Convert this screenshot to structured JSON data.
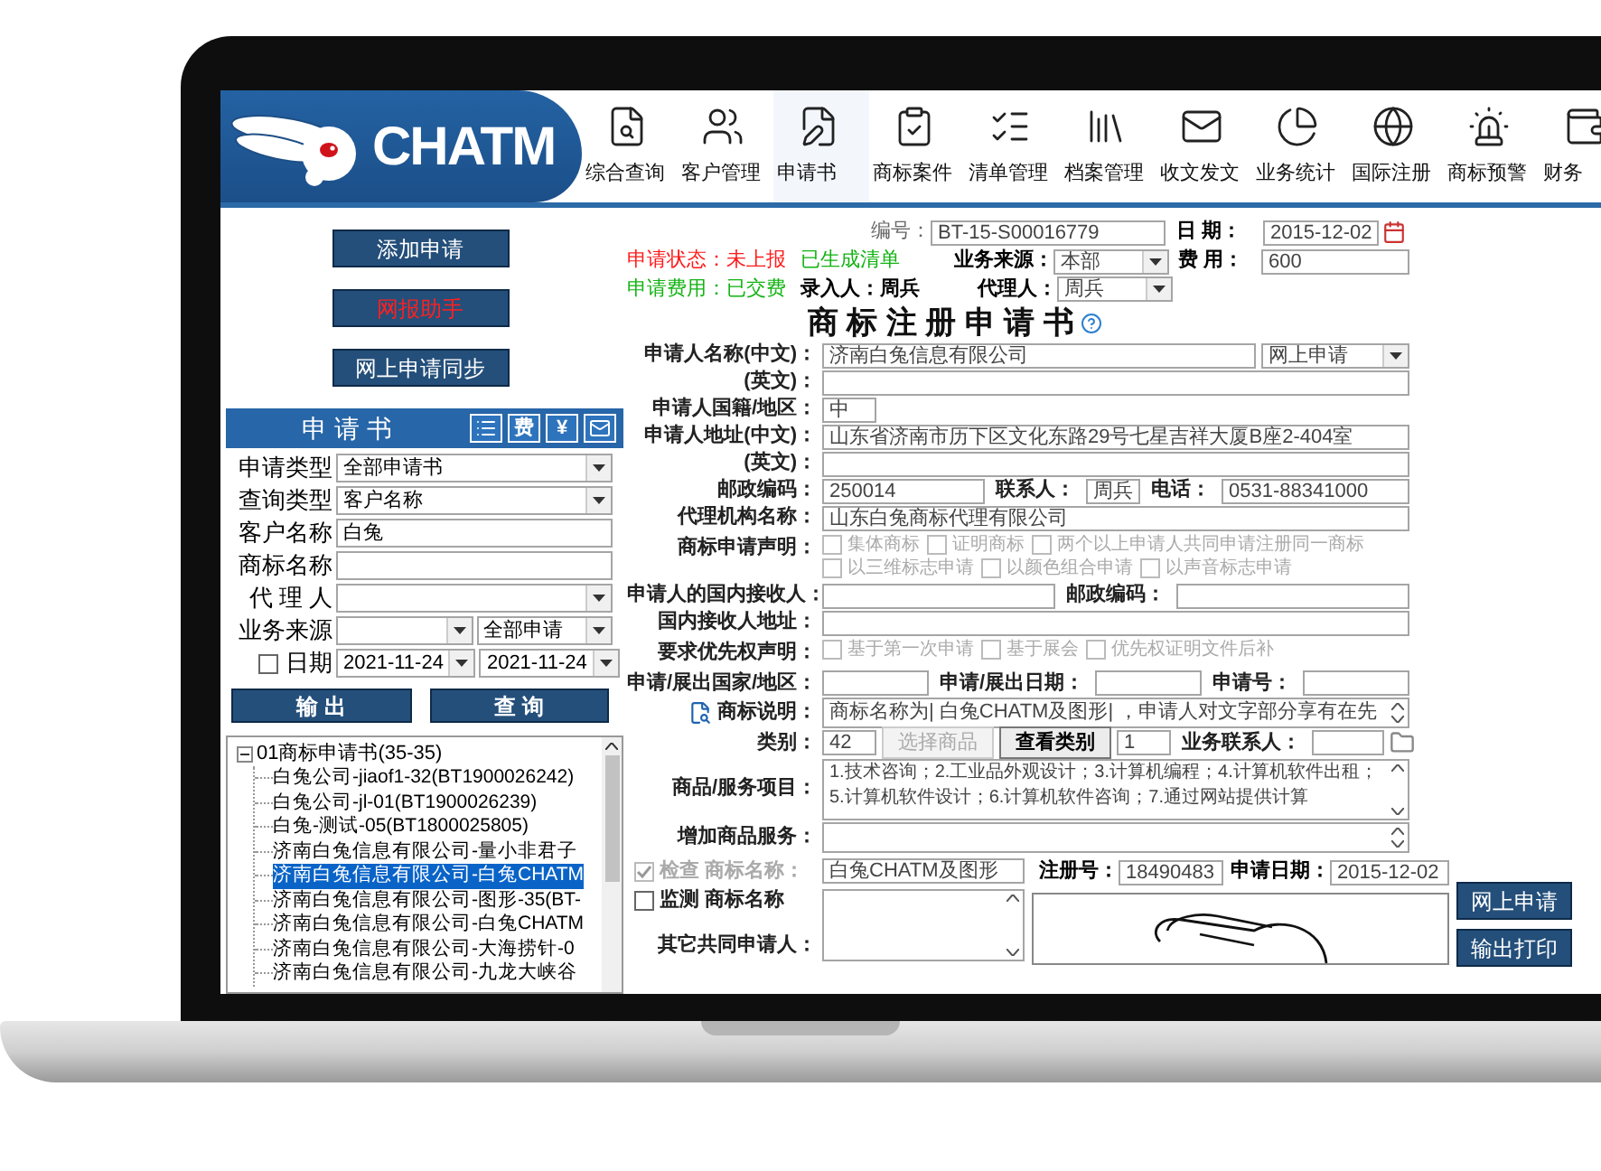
{
  "logo": {
    "text": "CHATM"
  },
  "nav": [
    {
      "label": "综合查询",
      "kind": "query",
      "selected": false
    },
    {
      "label": "客户管理",
      "kind": "customers",
      "selected": false
    },
    {
      "label": "申请书",
      "kind": "application",
      "selected": true
    },
    {
      "label": "商标案件",
      "kind": "case",
      "selected": false
    },
    {
      "label": "清单管理",
      "kind": "list",
      "selected": false
    },
    {
      "label": "档案管理",
      "kind": "archive",
      "selected": false
    },
    {
      "label": "收文发文",
      "kind": "mail",
      "selected": false
    },
    {
      "label": "业务统计",
      "kind": "stats",
      "selected": false
    },
    {
      "label": "国际注册",
      "kind": "globe",
      "selected": false
    },
    {
      "label": "商标预警",
      "kind": "alert",
      "selected": false
    },
    {
      "label": "财务",
      "kind": "finance",
      "selected": false
    }
  ],
  "left_panel": {
    "actions": [
      {
        "label": "添加申请",
        "kind": "normal"
      },
      {
        "label": "网报助手",
        "kind": "alert"
      },
      {
        "label": "网上申请同步",
        "kind": "normal"
      }
    ],
    "section": {
      "title": "申 请 书",
      "tools": [
        {
          "kind": "list"
        },
        {
          "kind": "text",
          "label": "费"
        },
        {
          "kind": "text",
          "label": "¥"
        },
        {
          "kind": "mail"
        }
      ]
    },
    "filters": [
      {
        "label": "申请类型",
        "fields": [
          {
            "kind": "select",
            "value": "全部申请书"
          }
        ]
      },
      {
        "label": "查询类型",
        "fields": [
          {
            "kind": "select",
            "value": "客户名称"
          }
        ]
      },
      {
        "label": "客户名称",
        "fields": [
          {
            "kind": "input",
            "value": "白兔"
          }
        ]
      },
      {
        "label": "商标名称",
        "fields": [
          {
            "kind": "input"
          }
        ]
      },
      {
        "label": "代 理 人",
        "fields": [
          {
            "kind": "select"
          }
        ]
      },
      {
        "label": "业务来源",
        "fields": [
          {
            "kind": "select"
          },
          {
            "kind": "select",
            "value": "全部申请"
          }
        ]
      },
      {
        "label": "日期",
        "checked": false,
        "fields": [
          {
            "kind": "select",
            "value": "2021-11-24"
          },
          {
            "kind": "select",
            "value": "2021-11-24"
          }
        ]
      }
    ],
    "buttons": [
      "输 出",
      "查 询"
    ],
    "tree": {
      "label": "01商标申请书(35-35)",
      "expanded": true,
      "children": [
        {
          "label": "白兔公司-jiaof1-32(BT1900026242)",
          "selected": false
        },
        {
          "label": "白兔公司-jl-01(BT1900026239)",
          "selected": false
        },
        {
          "label": "白兔-测试-05(BT1800025805)",
          "selected": false
        },
        {
          "label": "济南白兔信息有限公司-量小非君子",
          "selected": false
        },
        {
          "label": "济南白兔信息有限公司-白兔CHATM",
          "selected": true
        },
        {
          "label": "济南白兔信息有限公司-图形-35(BT-",
          "selected": false
        },
        {
          "label": "济南白兔信息有限公司-白兔CHATM",
          "selected": false
        },
        {
          "label": "济南白兔信息有限公司-大海捞针-0",
          "selected": false
        },
        {
          "label": "济南白兔信息有限公司-九龙大峡谷",
          "selected": false
        }
      ]
    }
  },
  "form": {
    "header": {
      "number_label": "编号：",
      "number": "BT-15-S00016779",
      "date_label": "日 期：",
      "date": "2015-12-02",
      "status": "申请状态：未上报",
      "list_status": "已生成清单",
      "source_label": "业务来源：",
      "source": "本部",
      "fee_label": "费 用：",
      "fee": "600",
      "payment": "申请费用：已交费",
      "entered_by": "录入人：周兵",
      "agent_label": "代理人：",
      "agent": "周兵"
    },
    "title": "商 标 注 册 申 请 书",
    "rows": [
      {
        "kind": "fields",
        "label": "申请人名称(中文)：",
        "items": [
          {
            "kind": "input",
            "value": "济南白兔信息有限公司"
          },
          {
            "kind": "select",
            "value": "网上申请"
          }
        ]
      },
      {
        "kind": "fields",
        "label": "(英文)：",
        "items": [
          {
            "kind": "input"
          }
        ]
      },
      {
        "kind": "fields",
        "label": "申请人国籍/地区：",
        "items": [
          {
            "kind": "short",
            "value": "中"
          }
        ]
      },
      {
        "kind": "fields",
        "label": "申请人地址(中文)：",
        "items": [
          {
            "kind": "input",
            "value": "山东省济南市历下区文化东路29号七星吉祥大厦B座2-404室"
          }
        ]
      },
      {
        "kind": "fields",
        "label": "(英文)：",
        "items": [
          {
            "kind": "input"
          }
        ]
      },
      {
        "kind": "fields",
        "label": "邮政编码：",
        "items": [
          {
            "kind": "short",
            "value": "250014"
          },
          {
            "kind": "label",
            "text": "联系人："
          },
          {
            "kind": "short",
            "value": "周兵"
          },
          {
            "kind": "label",
            "text": "电话："
          },
          {
            "kind": "input",
            "value": "0531-88341000"
          }
        ]
      },
      {
        "kind": "fields",
        "label": "代理机构名称：",
        "items": [
          {
            "kind": "input",
            "value": "山东白兔商标代理有限公司"
          }
        ]
      },
      {
        "kind": "checks",
        "label": "商标申请声明：",
        "options": [
          {
            "label": "集体商标",
            "checked": false,
            "disabled": true
          },
          {
            "label": "证明商标",
            "checked": false,
            "disabled": true
          },
          {
            "label": "两个以上申请人共同申请注册同一商标",
            "checked": false,
            "disabled": true
          },
          {
            "label": "以三维标志申请",
            "checked": false,
            "disabled": true
          },
          {
            "label": "以颜色组合申请",
            "checked": false,
            "disabled": true
          },
          {
            "label": "以声音标志申请",
            "checked": false,
            "disabled": true
          }
        ]
      },
      {
        "kind": "fields",
        "label": "申请人的国内接收人：",
        "items": [
          {
            "kind": "input"
          },
          {
            "kind": "label",
            "text": "邮政编码："
          },
          {
            "kind": "input"
          }
        ]
      },
      {
        "kind": "fields",
        "label": "国内接收人地址：",
        "items": [
          {
            "kind": "input"
          }
        ]
      },
      {
        "kind": "checks",
        "label": "要求优先权声明：",
        "options": [
          {
            "label": "基于第一次申请",
            "checked": false,
            "disabled": true
          },
          {
            "label": "基于展会",
            "checked": false,
            "disabled": true
          },
          {
            "label": "优先权证明文件后补",
            "checked": false,
            "disabled": true
          }
        ]
      },
      {
        "kind": "fields",
        "label": "申请/展出国家/地区：",
        "items": [
          {
            "kind": "input"
          },
          {
            "kind": "label",
            "text": "申请/展出日期："
          },
          {
            "kind": "input"
          },
          {
            "kind": "label",
            "text": "申请号："
          },
          {
            "kind": "input"
          }
        ]
      },
      {
        "kind": "memo",
        "label": "商标说明：",
        "value": "商标名称为| 白兔CHATM及图形| ，申请人对文字部分享有在先"
      },
      {
        "kind": "fields",
        "label": "类别：",
        "items": [
          {
            "kind": "short",
            "value": "42"
          },
          {
            "kind": "button",
            "text": "选择商品",
            "disabled": true
          },
          {
            "kind": "button",
            "text": "查看类别",
            "disabled": false
          },
          {
            "kind": "short",
            "value": "1"
          },
          {
            "kind": "label",
            "text": "业务联系人："
          },
          {
            "kind": "input"
          },
          {
            "kind": "folder"
          }
        ]
      },
      {
        "kind": "textarea",
        "label": "商品/服务项目：",
        "value": "1.技术咨询；2.工业品外观设计；3.计算机编程；4.计算机软件出租；5.计算机软件设计；6.计算机软件咨询；7.通过网站提供计算"
      },
      {
        "kind": "memo",
        "label": "增加商品服务："
      }
    ],
    "extra": {
      "checks": [
        {
          "label": "检查 商标名称：",
          "checked": true,
          "disabled": true
        },
        {
          "label": "监测 商标名称",
          "checked": false,
          "disabled": false
        }
      ],
      "mark_name": "白兔CHATM及图形",
      "reg_label": "注册号：",
      "reg": "18490483",
      "date_label": "申请日期：",
      "date": "2015-12-02",
      "co_label": "其它共同申请人："
    }
  },
  "side_buttons": [
    "网上申请",
    "输出打印"
  ]
}
